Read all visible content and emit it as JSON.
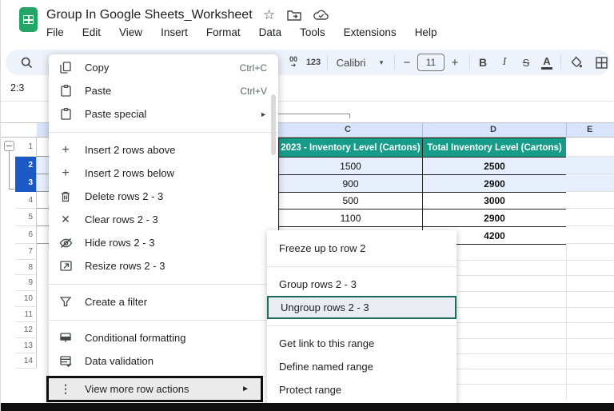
{
  "titlebar": {
    "title": "Group In Google Sheets_Worksheet",
    "menu": [
      "File",
      "Edit",
      "View",
      "Insert",
      "Format",
      "Data",
      "Tools",
      "Extensions",
      "Help"
    ]
  },
  "icons": {
    "star_glyph": "☆",
    "caret_down_glyph": "▾",
    "submenu_arrow_glyph": "►",
    "plus_glyph": "+",
    "close_glyph": "✕",
    "kebab_glyph": "⋮"
  },
  "toolbar": {
    "decimal_top": "00",
    "decimal_arrow": "➜",
    "number_format": "123",
    "font_name": "Calibri",
    "decrease_size": "−",
    "font_size": "11",
    "increase_size": "+",
    "bold": "B",
    "italic": "I",
    "strikethrough": "S",
    "text_color": "A"
  },
  "formula_bar": {
    "name_box": "2:3"
  },
  "context_menu": {
    "items": [
      {
        "label": "Copy",
        "shortcut": "Ctrl+C"
      },
      {
        "label": "Paste",
        "shortcut": "Ctrl+V"
      },
      {
        "label": "Paste special",
        "shortcut": ""
      },
      {
        "label": "Insert 2 rows above",
        "shortcut": ""
      },
      {
        "label": "Insert 2 rows below",
        "shortcut": ""
      },
      {
        "label": "Delete rows 2 - 3",
        "shortcut": ""
      },
      {
        "label": "Clear rows 2 - 3",
        "shortcut": ""
      },
      {
        "label": "Hide rows 2 - 3",
        "shortcut": ""
      },
      {
        "label": "Resize rows 2 - 3",
        "shortcut": ""
      },
      {
        "label": "Create a filter",
        "shortcut": ""
      },
      {
        "label": "Conditional formatting",
        "shortcut": ""
      },
      {
        "label": "Data validation",
        "shortcut": ""
      }
    ],
    "footer": {
      "label": "View more row actions"
    }
  },
  "submenu": {
    "items": [
      {
        "label": "Freeze up to row 2"
      },
      {
        "label": "Group rows 2 - 3"
      },
      {
        "label": "Ungroup rows 2 - 3",
        "highlighted": true
      },
      {
        "label": "Get link to this range"
      },
      {
        "label": "Define named range"
      },
      {
        "label": "Protect range"
      }
    ]
  },
  "sheet": {
    "columns": [
      "C",
      "D",
      "E"
    ],
    "row_numbers": [
      "1",
      "2",
      "3",
      "4",
      "5",
      "6",
      "7",
      "8",
      "9",
      "10",
      "11",
      "12",
      "13",
      "14"
    ],
    "selected_rows": [
      2,
      3
    ],
    "table": {
      "header": [
        "2023 - Inventory Level (Cartons)",
        "Total Inventory Level (Cartons)"
      ],
      "data": [
        [
          "1500",
          "2500"
        ],
        [
          "900",
          "2900"
        ],
        [
          "500",
          "3000"
        ],
        [
          "1100",
          "2900"
        ],
        [
          "",
          "4200"
        ]
      ]
    },
    "colors": {
      "table_header_bg": "#189c8a",
      "selected_row_header_bg": "#1b5ac6",
      "selection_tint": "#e8effc",
      "column_header_bg": "#d8e4fc",
      "ungroup_highlight_border": "#1c6b5f"
    }
  }
}
